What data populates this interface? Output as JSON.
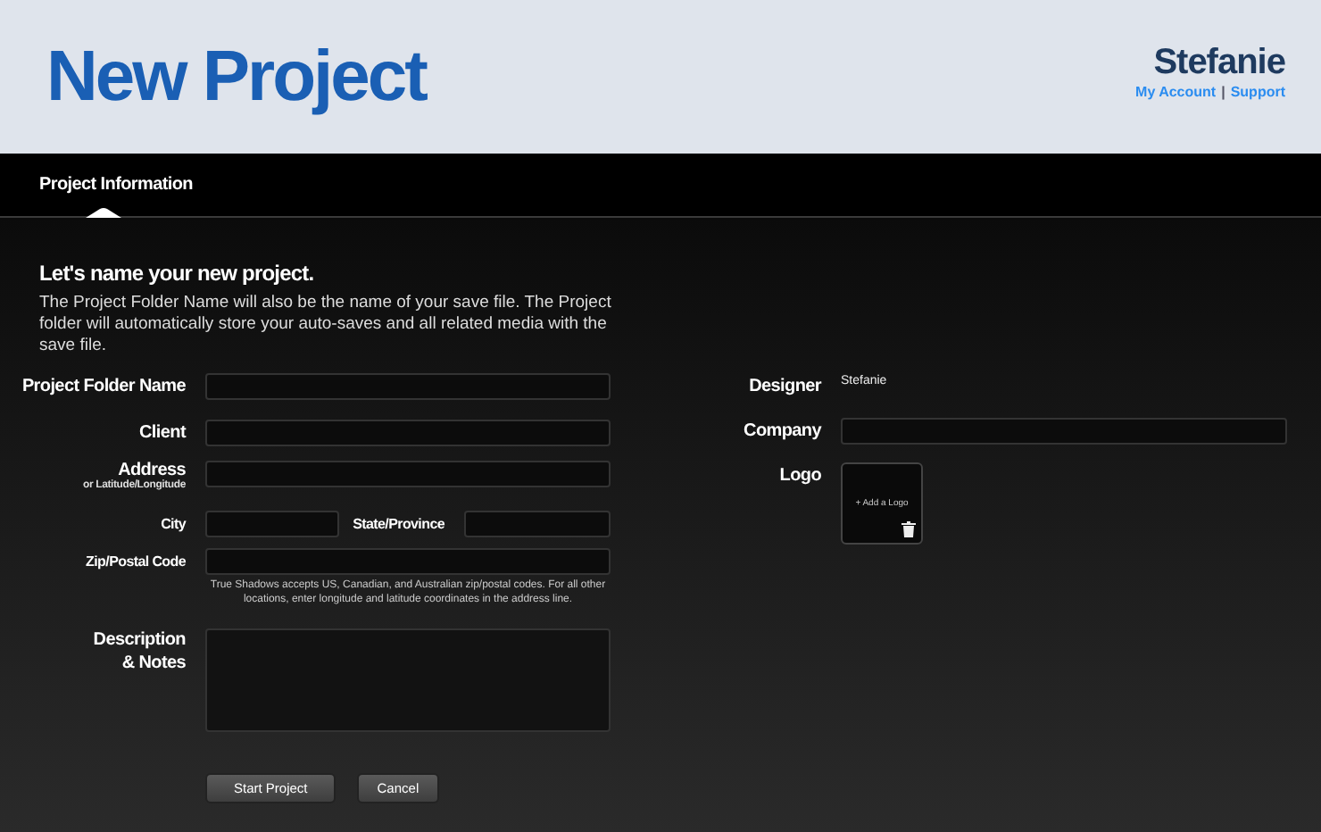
{
  "header": {
    "title": "New Project",
    "user": "Stefanie",
    "links": [
      "My Account",
      "Support"
    ],
    "separator": "|"
  },
  "tabs": [
    {
      "label": "Project Information",
      "selected": true
    }
  ],
  "intro": {
    "heading": "Let's name your new project.",
    "text": "The Project Folder Name will also be the name of your save file. The Project folder will automatically store your auto-saves and all related media with the save file."
  },
  "form": {
    "folder": {
      "label": "Project Folder Name"
    },
    "client": {
      "label": "Client"
    },
    "address": {
      "label": "Address",
      "sublabel": "or Latitude/Longitude"
    },
    "city": {
      "label": "City"
    },
    "state": {
      "label": "State/Province"
    },
    "zip": {
      "label": "Zip/Postal Code"
    },
    "zip_note": "True Shadows accepts US, Canadian, and Australian zip/postal codes. For all other locations, enter longitude and latitude coordinates in the address line.",
    "notes": {
      "label": "Description & Notes"
    }
  },
  "details": {
    "designer": {
      "label": "Designer",
      "value": "Stefanie"
    },
    "company": {
      "label": "Company"
    },
    "logo": {
      "label": "Logo",
      "hint": "+ Add a Logo"
    }
  },
  "buttons": [
    {
      "label": "Start Project",
      "kind": "primary"
    },
    {
      "label": "Cancel",
      "kind": "secondary"
    }
  ]
}
